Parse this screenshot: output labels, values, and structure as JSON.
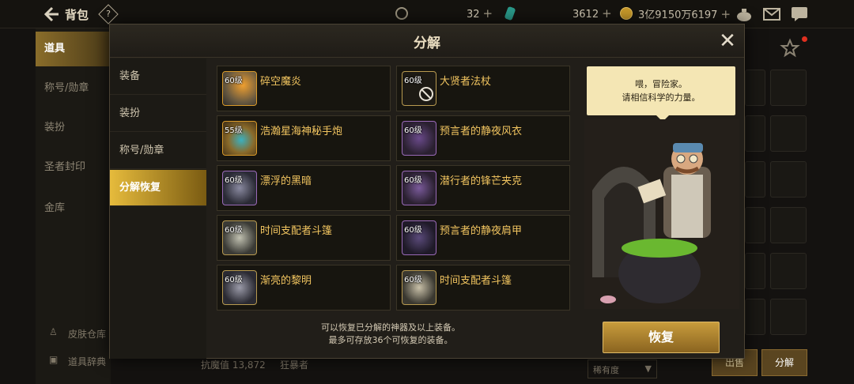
{
  "topbar": {
    "title": "背包",
    "help": "?",
    "currency_a": "32",
    "currency_b": "3612",
    "currency_c": "3亿9150万6197",
    "plus": "+"
  },
  "bg_nav": {
    "items": [
      "道具",
      "称号/勋章",
      "装扮",
      "圣者封印",
      "金库"
    ],
    "active": "道具"
  },
  "bg_bottom": {
    "skin_storage": "皮肤仓库",
    "item_dict": "道具辞典",
    "resist_value": "抗魔值 13,872",
    "class_label": "狂暴者",
    "sort": "稀有度",
    "btn_sell": "出售",
    "btn_disassemble": "分解"
  },
  "modal": {
    "title": "分解",
    "close": "✕",
    "tabs": [
      "装备",
      "装扮",
      "称号/勋章",
      "分解恢复"
    ],
    "active_tab": "分解恢复",
    "items": [
      {
        "level": "60级",
        "name": "碎空魔炎"
      },
      {
        "level": "60级",
        "name": "大贤者法杖"
      },
      {
        "level": "55级",
        "name": "浩瀚星海神秘手炮"
      },
      {
        "level": "60级",
        "name": "预言者的静夜风衣"
      },
      {
        "level": "60级",
        "name": "漂浮的黑暗"
      },
      {
        "level": "60级",
        "name": "潜行者的锋芒夹克"
      },
      {
        "level": "60级",
        "name": "时间支配者斗篷"
      },
      {
        "level": "60级",
        "name": "预言者的静夜肩甲"
      },
      {
        "level": "60级",
        "name": "渐亮的黎明"
      },
      {
        "level": "60级",
        "name": "时间支配者斗篷"
      }
    ],
    "note_line1": "可以恢复已分解的神器及以上装备。",
    "note_line2": "最多可存放36个可恢复的装备。",
    "restore_button": "恢复",
    "bubble_line1": "喂，冒险家。",
    "bubble_line2": "请相信科学的力量。"
  },
  "colors": {
    "accent_gold": "#e6bb3c",
    "item_name": "#f2c560",
    "bubble_bg": "#f4e6b4"
  }
}
